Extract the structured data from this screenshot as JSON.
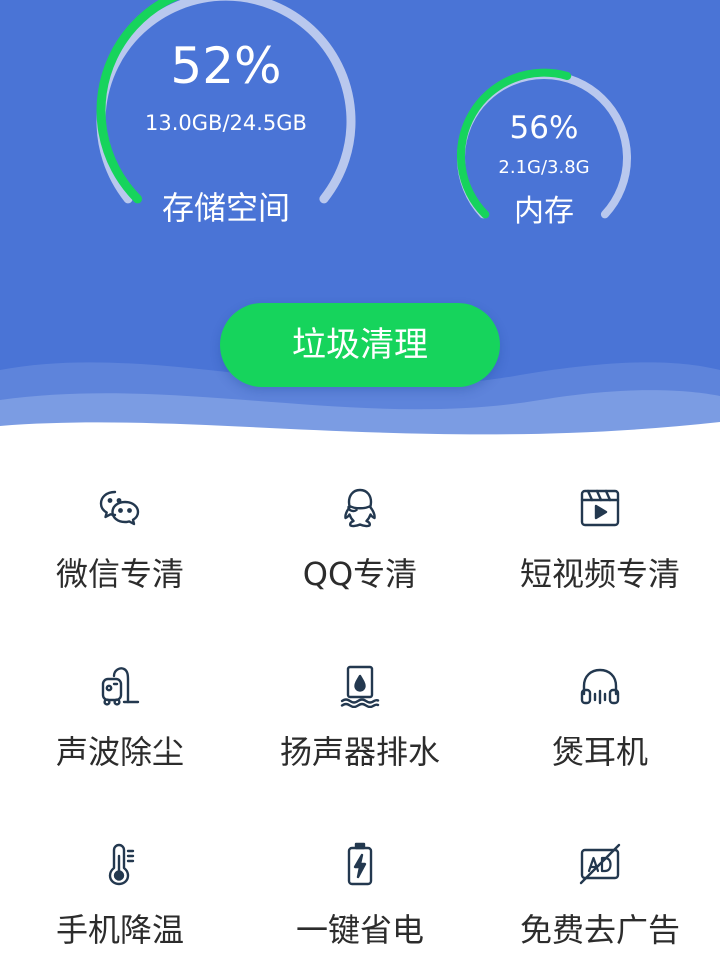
{
  "storage": {
    "percent": "52%",
    "usage": "13.0GB/24.5GB",
    "label": "存储空间",
    "fraction": 0.52
  },
  "memory": {
    "percent": "56%",
    "usage": "2.1G/3.8G",
    "label": "内存",
    "fraction": 0.56
  },
  "clean_button": {
    "label": "垃圾清理"
  },
  "colors": {
    "header_bg": "#4a74d6",
    "accent_green": "#16d45c",
    "icon_dark": "#23384f"
  },
  "tools": [
    {
      "label": "微信专清",
      "icon": "wechat-icon"
    },
    {
      "label": "QQ专清",
      "icon": "qq-icon"
    },
    {
      "label": "短视频专清",
      "icon": "video-icon"
    },
    {
      "label": "声波除尘",
      "icon": "vacuum-icon"
    },
    {
      "label": "扬声器排水",
      "icon": "speaker-water-icon"
    },
    {
      "label": "煲耳机",
      "icon": "headphones-icon"
    },
    {
      "label": "手机降温",
      "icon": "thermometer-icon"
    },
    {
      "label": "一键省电",
      "icon": "battery-icon"
    },
    {
      "label": "免费去广告",
      "icon": "no-ad-icon"
    }
  ]
}
